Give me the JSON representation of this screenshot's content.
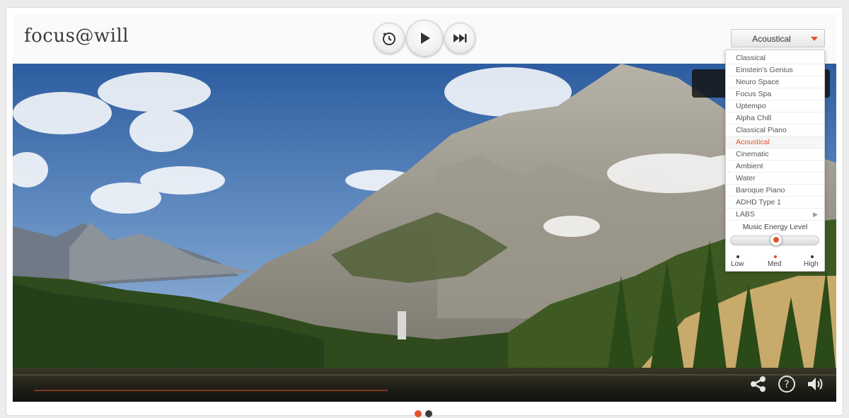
{
  "app": {
    "logo_text": "focus@will"
  },
  "controls": {
    "timer_icon": "timer-icon",
    "play_icon": "play-icon",
    "skip_icon": "skip-forward-icon"
  },
  "genre": {
    "selected": "Acoustical"
  },
  "dropdown": {
    "items": [
      "Classical",
      "Einstein's Genius",
      "Neuro Space",
      "Focus Spa",
      "Uptempo",
      "Alpha Chill",
      "Classical Piano",
      "Acoustical",
      "Cinematic",
      "Ambient",
      "Water",
      "Baroque Piano",
      "ADHD Type 1",
      "LABS"
    ],
    "active_index": 7,
    "energy": {
      "title": "Music Energy Level",
      "low": "Low",
      "med": "Med",
      "high": "High",
      "level": 0.5
    }
  },
  "bottom_bar": {
    "share_icon": "share-icon",
    "help_icon": "help-icon",
    "volume_icon": "volume-icon"
  },
  "pagination": {
    "count": 2,
    "active": 0
  },
  "colors": {
    "accent": "#e2522b"
  }
}
